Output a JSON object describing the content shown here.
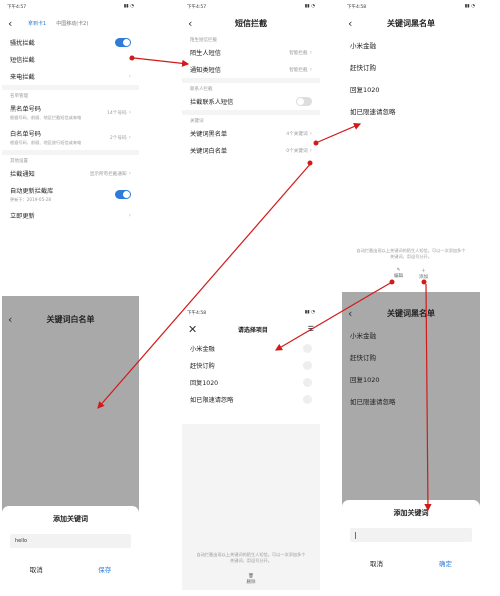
{
  "screen1": {
    "status_time": "下午4:57",
    "tab_active": "拿到卡1",
    "tab_other": "中国移动(卡2)",
    "rows": [
      {
        "label": "骚扰拦截"
      },
      {
        "label": "短信拦截"
      },
      {
        "label": "来电拦截"
      }
    ],
    "section_list": "名单管理",
    "blacklist": {
      "label": "黑名单号码",
      "sub": "根据号码、前缀、地区拦截短信或来电",
      "value": "14个号码"
    },
    "whitelist": {
      "label": "白名单号码",
      "sub": "根据号码、前缀、地区放行短信或来电",
      "value": "2个号码"
    },
    "section_other": "其他设置",
    "notify": {
      "label": "拦截通知",
      "value": "显示所有拦截通知"
    },
    "autoupdate": {
      "label": "自动更新拦截库",
      "sub": "更新于：2019-05-28"
    },
    "update_now": "立即更新"
  },
  "screen2": {
    "status_time": "下午4:57",
    "title": "短信拦截",
    "section_sender": "陌生短信拦截",
    "stranger": {
      "label": "陌生人短信",
      "value": "智能拦截"
    },
    "notice": {
      "label": "通知类短信",
      "value": "智能拦截"
    },
    "section_contact": "联系人拦截",
    "contact": {
      "label": "拦截联系人短信"
    },
    "section_keyword": "关键词",
    "kw_black": {
      "label": "关键词黑名单",
      "value": "4个关键词"
    },
    "kw_white": {
      "label": "关键词白名单",
      "value": "0个关键词"
    }
  },
  "screen3": {
    "status_time": "下午4:58",
    "title": "关键词黑名单",
    "items": [
      "小米金融",
      "赶快订购",
      "回复1020",
      "如已限速请忽略"
    ],
    "hint": "自动拦截出现以上关键词的陌生人短信。可以一次添加多个关键词，用逗号分开。",
    "edit_label": "编辑",
    "add_label": "添加"
  },
  "screen4": {
    "title": "关键词白名单",
    "dialog_title": "添加关键词",
    "input_value": "hello",
    "cancel": "取消",
    "save": "保存"
  },
  "screen5": {
    "status_time": "下午4:58",
    "title": "请选择项目",
    "items": [
      "小米金融",
      "赶快订购",
      "回复1020",
      "如已限速请忽略"
    ],
    "hint": "自动拦截出现以上关键词的陌生人短信。可以一次添加多个关键词，用逗号分开。",
    "delete_label": "删除"
  },
  "screen6": {
    "title": "关键词黑名单",
    "items": [
      "小米金融",
      "赶快订购",
      "回复1020",
      "如已限速请忽略"
    ],
    "dialog_title": "添加关键词",
    "cancel": "取消",
    "confirm": "确定"
  },
  "colors": {
    "accent": "#2f7bd9",
    "arrow": "#d11a1a",
    "overlay": "#a9a9a9"
  }
}
